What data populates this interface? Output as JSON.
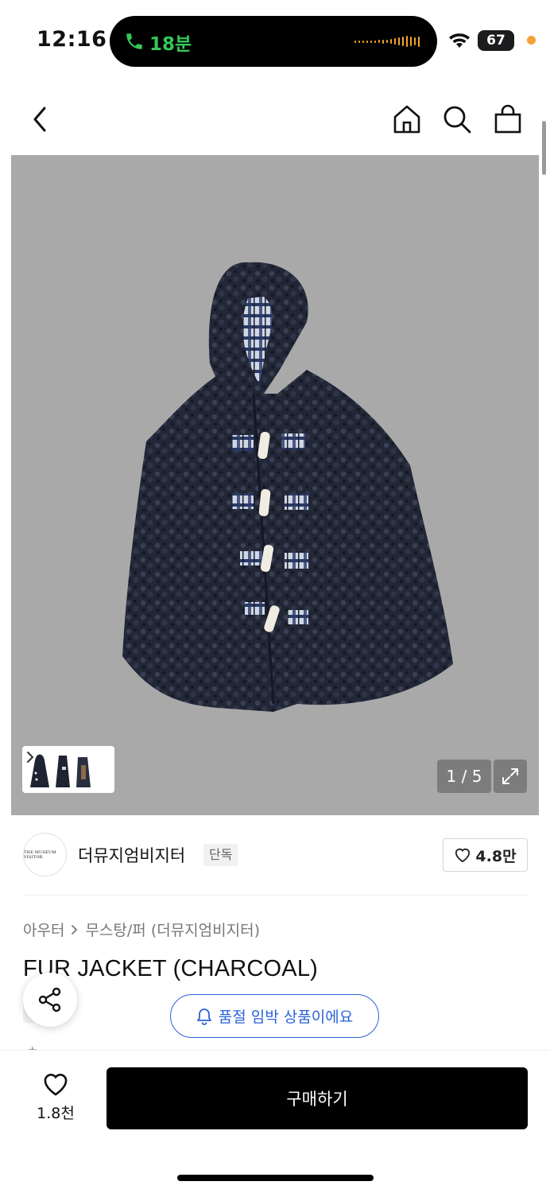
{
  "status_bar": {
    "time": "12:16",
    "call_duration": "18분",
    "battery": "67"
  },
  "header": {
    "back_icon": "chevron-left-icon",
    "home_icon": "home-icon",
    "search_icon": "search-icon",
    "cart_icon": "shopping-bag-icon"
  },
  "gallery": {
    "counter": "1 / 5",
    "current_index": 1,
    "total": 5
  },
  "brand": {
    "logo_text": "THE MUSEUM VISITOR",
    "name": "더뮤지엄비지터",
    "badge": "단독",
    "likes": "4.8만"
  },
  "breadcrumb": {
    "category": "아우터",
    "subcategory": "무스탕/퍼 (더뮤지엄비지터)"
  },
  "product": {
    "title": "FUR JACKET (CHARCOAL)",
    "badge": "단독"
  },
  "toast": {
    "message": "품절 임박 상품이에요"
  },
  "bottom_bar": {
    "wish_count": "1.8천",
    "buy_label": "구매하기"
  },
  "colors": {
    "image_background": "#a9a9a9",
    "coat": "#1f2433",
    "toast_accent": "#2b63d9",
    "buy_button": "#000000"
  }
}
